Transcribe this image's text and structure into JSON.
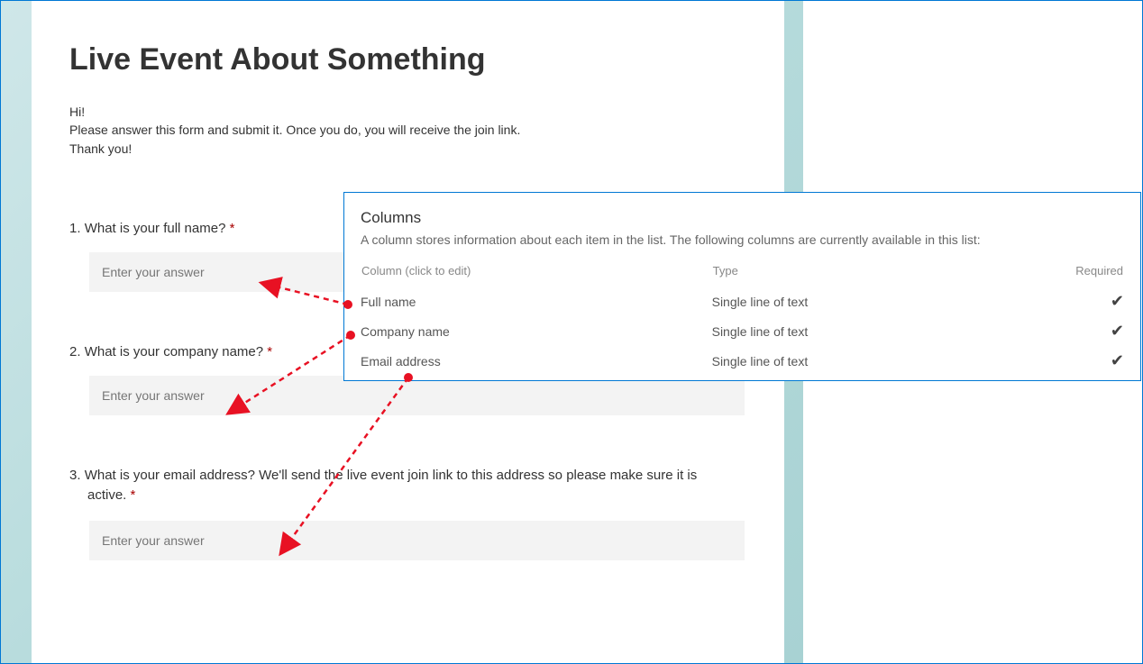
{
  "form": {
    "title": "Live Event About Something",
    "intro_line1": "Hi!",
    "intro_line2": "Please answer this form and submit it. Once you do, you will receive the join link.",
    "intro_line3": "Thank you!",
    "placeholder": "Enter your answer",
    "required_marker": "*",
    "questions": {
      "q1": {
        "num": "1.",
        "text": "What is your full name?"
      },
      "q2": {
        "num": "2.",
        "text": "What is your company name?"
      },
      "q3": {
        "num": "3.",
        "text": "What is your email address? We'll send the live event join link to this address so please make sure it is active."
      }
    }
  },
  "panel": {
    "title": "Columns",
    "desc": "A column stores information about each item in the list. The following columns are currently available in this list:",
    "header_name": "Column (click to edit)",
    "header_type": "Type",
    "header_required": "Required",
    "rows": {
      "r1": {
        "name": "Full name",
        "type": "Single line of text",
        "required": "✔"
      },
      "r2": {
        "name": "Company name",
        "type": "Single line of text",
        "required": "✔"
      },
      "r3": {
        "name": "Email address",
        "type": "Single line of text",
        "required": "✔"
      }
    }
  }
}
